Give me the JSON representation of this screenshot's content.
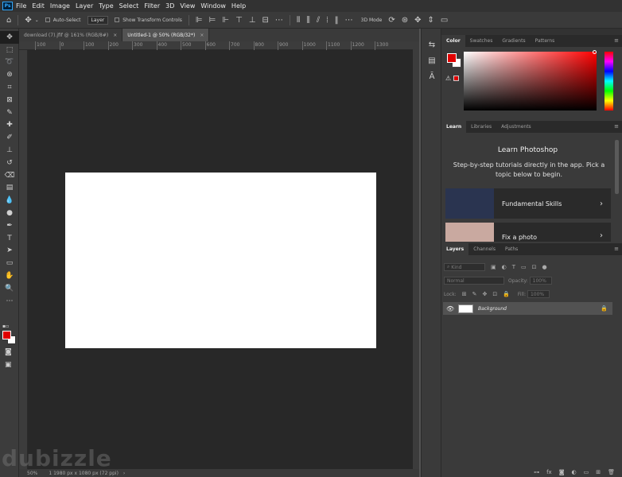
{
  "app": {
    "logo_text": "Ps"
  },
  "menu": [
    "File",
    "Edit",
    "Image",
    "Layer",
    "Type",
    "Select",
    "Filter",
    "3D",
    "View",
    "Window",
    "Help"
  ],
  "options_bar": {
    "auto_select_label": "Auto-Select",
    "layer_dropdown": "Layer",
    "transform_label": "Show Transform Controls",
    "mode_3d": "3D Mode"
  },
  "tabs": [
    {
      "label": "download (7).jfif @ 161% (RGB/8#)",
      "close": "×"
    },
    {
      "label": "Untitled-1 @ 50% (RGB/32*)",
      "close": "×"
    }
  ],
  "ruler_labels": [
    "100",
    "0",
    "100",
    "200",
    "300",
    "400",
    "500",
    "600",
    "700",
    "800",
    "900",
    "1000",
    "1100",
    "1200",
    "1300"
  ],
  "status": {
    "zoom": "50%",
    "info": "1 1980 px x 1080 px (72 ppi)"
  },
  "watermark": "dubizzle",
  "colors": {
    "foreground": "#e00000",
    "background": "#ffffff",
    "accent": "#31a8ff"
  },
  "color_panel": {
    "tabs": [
      "Color",
      "Swatches",
      "Gradients",
      "Patterns"
    ]
  },
  "learn_panel": {
    "tabs": [
      "Learn",
      "Libraries",
      "Adjustments"
    ],
    "title": "Learn Photoshop",
    "description": "Step-by-step tutorials directly in the app. Pick a topic below to begin.",
    "cards": [
      {
        "label": "Fundamental Skills",
        "thumb_color": "#2a3450"
      },
      {
        "label": "Fix a photo",
        "thumb_color": "#c9a9a0"
      }
    ]
  },
  "layers_panel": {
    "tabs": [
      "Layers",
      "Channels",
      "Paths"
    ],
    "search_placeholder": "Kind",
    "blend_mode": "Normal",
    "opacity_label": "Opacity:",
    "opacity_value": "100%",
    "lock_label": "Lock:",
    "fill_label": "Fill:",
    "fill_value": "100%",
    "layers": [
      {
        "name": "Background",
        "visible": true,
        "locked": true
      }
    ]
  },
  "icons": {
    "tools": [
      "move-icon",
      "marquee-icon",
      "lasso-icon",
      "quick-select-icon",
      "crop-icon",
      "frame-icon",
      "eyedropper-icon",
      "healing-icon",
      "brush-icon",
      "stamp-icon",
      "history-brush-icon",
      "eraser-icon",
      "gradient-icon",
      "blur-icon",
      "dodge-icon",
      "pen-icon",
      "type-icon",
      "path-select-icon",
      "rectangle-icon",
      "hand-icon",
      "zoom-icon",
      "more-tools-icon"
    ],
    "tool_glyphs": [
      "✥",
      "⬚",
      "➰",
      "⊛",
      "⌗",
      "⊠",
      "✎",
      "✚",
      "✐",
      "⊥",
      "↺",
      "⌫",
      "▤",
      "💧",
      "●",
      "✒",
      "T",
      "➤",
      "▭",
      "✋",
      "🔍",
      "⋯"
    ]
  }
}
